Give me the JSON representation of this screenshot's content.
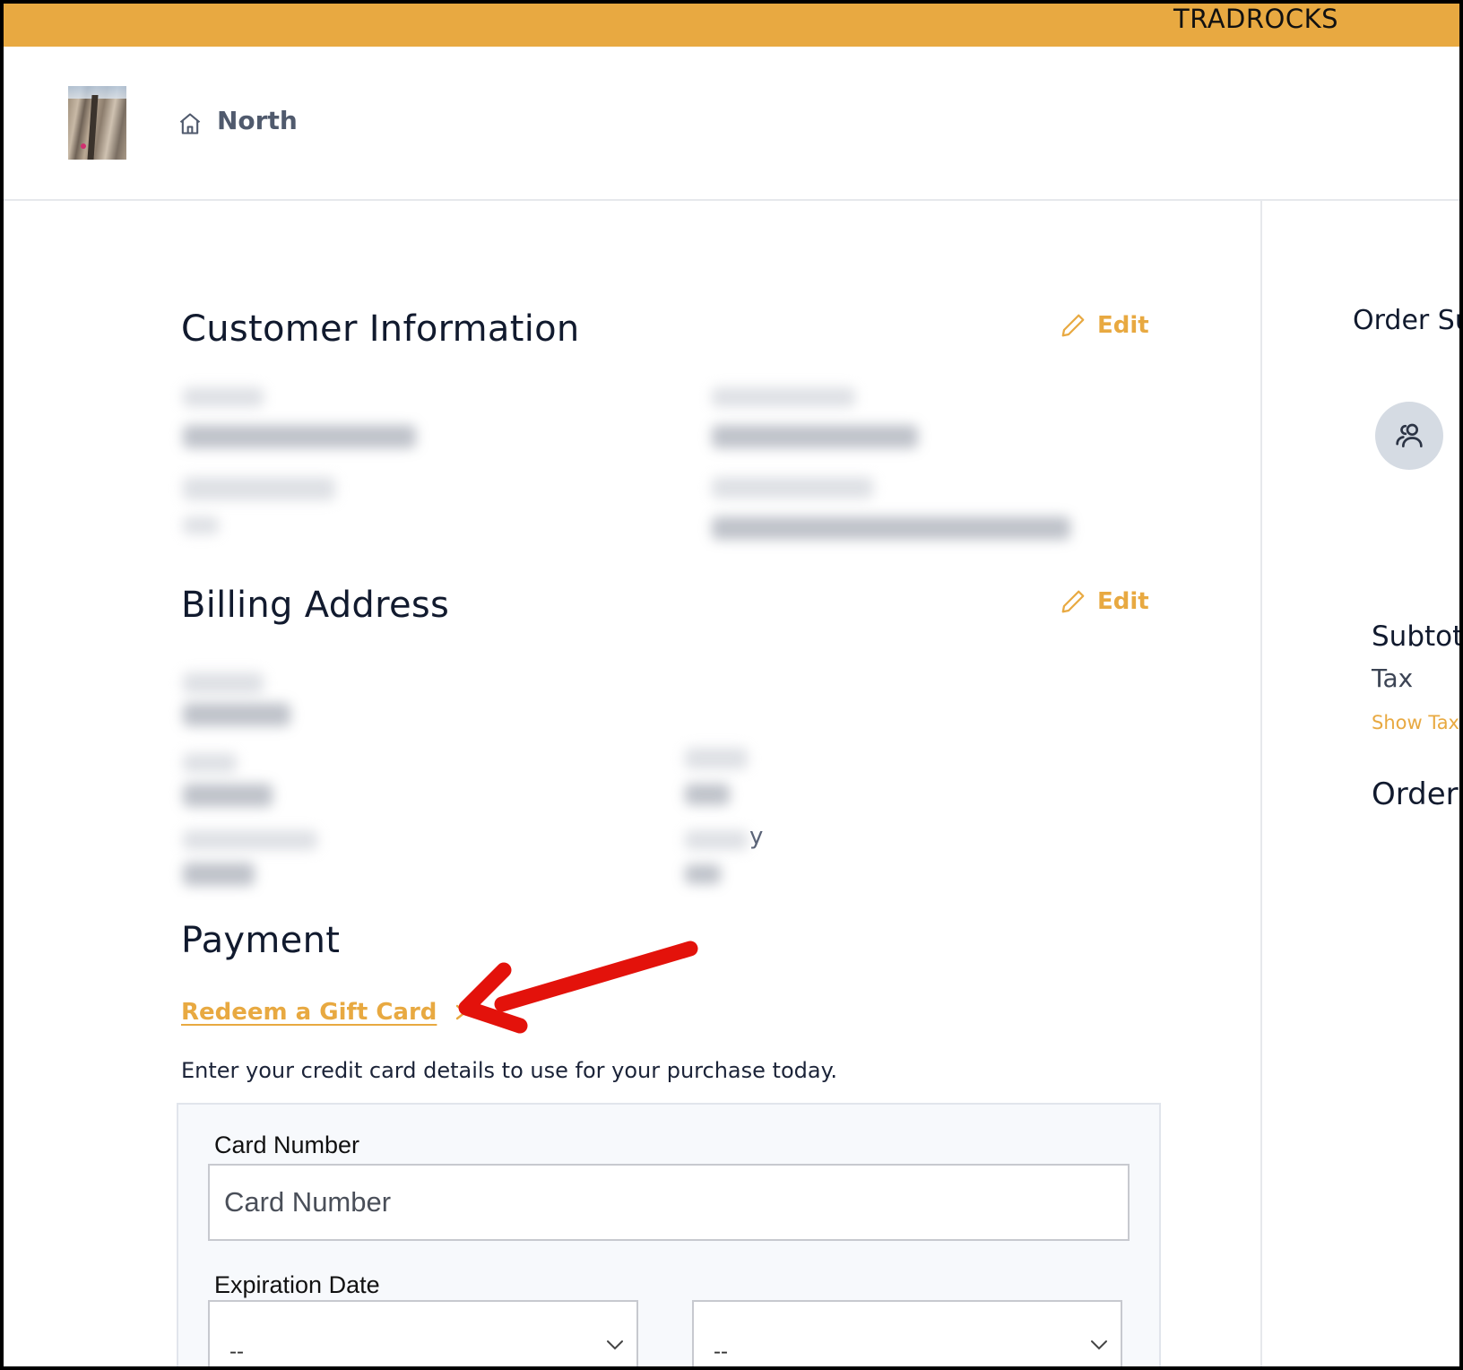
{
  "topbar": {
    "brand": "TRADROCKS"
  },
  "header": {
    "location_name": "North"
  },
  "customer_info": {
    "title": "Customer Information",
    "edit_label": "Edit"
  },
  "billing": {
    "title": "Billing Address",
    "edit_label": "Edit",
    "visible_fragment": "y"
  },
  "payment": {
    "title": "Payment",
    "gift_card_link": "Redeem a Gift Card",
    "description": "Enter your credit card details to use for your purchase today.",
    "card_number_label": "Card Number",
    "card_number_placeholder": "Card Number",
    "expiration_label": "Expiration Date",
    "exp_month_value": "--",
    "exp_year_value": "--"
  },
  "sidebar": {
    "title": "Order Su",
    "subtotal_label": "Subtot",
    "tax_label": "Tax",
    "show_tax_link": "Show Tax",
    "order_total_label": "Order"
  },
  "icons": {
    "home": "home-icon",
    "edit": "pencil-icon",
    "chevron": "chevron-right-icon",
    "select": "chevron-down-icon",
    "avatar": "users-icon"
  },
  "colors": {
    "accent": "#e8a941",
    "text": "#111a2e",
    "annotation_arrow": "#e3120b"
  }
}
